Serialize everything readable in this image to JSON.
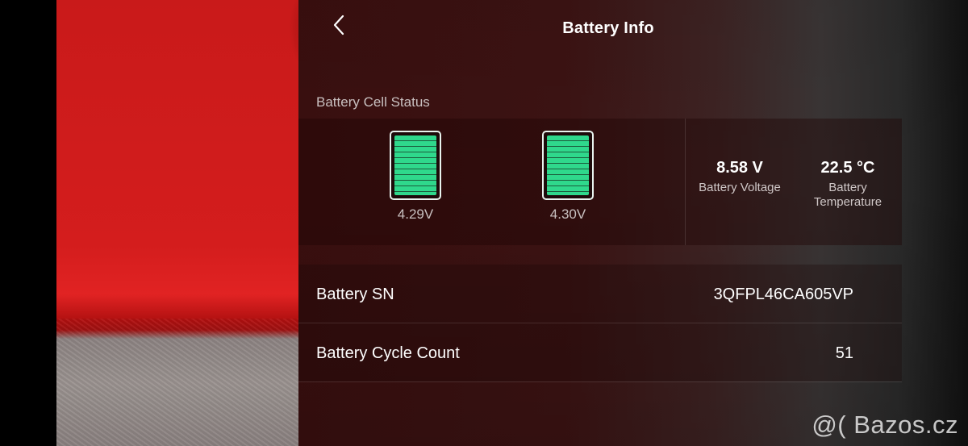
{
  "header": {
    "title": "Battery Info",
    "back_icon": "chevron-left-icon"
  },
  "cell_status": {
    "label": "Battery Cell Status",
    "cells": [
      {
        "voltage": "4.29V",
        "charge_fraction": 1.0
      },
      {
        "voltage": "4.30V",
        "charge_fraction": 1.0
      }
    ],
    "cell_fill_color": "#2fd88c"
  },
  "stats": {
    "voltage": {
      "value": "8.58 V",
      "label": "Battery Voltage"
    },
    "temperature": {
      "value": "22.5 °C",
      "label_line1": "Battery",
      "label_line2": "Temperature"
    }
  },
  "info": {
    "sn": {
      "label": "Battery SN",
      "value": "3QFPL46CA605VP"
    },
    "cycle": {
      "label": "Battery Cycle Count",
      "value": "51"
    }
  },
  "watermark": "@( Bazos.cz"
}
